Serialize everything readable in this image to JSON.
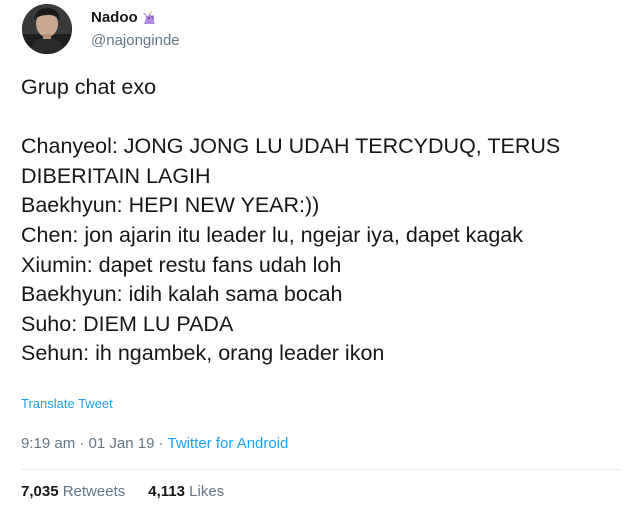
{
  "author": {
    "display_name": "Nadoo",
    "badge_icon": "unicorn-icon",
    "handle": "@najonginde"
  },
  "tweet": {
    "lines": [
      "Grup chat exo",
      "",
      "Chanyeol: JONG JONG LU UDAH TERCYDUQ, TERUS",
      "DIBERITAIN LAGIH",
      "Baekhyun: HEPI NEW YEAR:))",
      "Chen: jon ajarin itu leader lu, ngejar iya, dapet kagak",
      "Xiumin: dapet restu fans udah loh",
      "Baekhyun: idih kalah sama bocah",
      "Suho: DIEM LU PADA",
      "Sehun: ih ngambek, orang leader ikon"
    ],
    "translate_label": "Translate Tweet"
  },
  "meta": {
    "time": "9:19 am",
    "separator": "·",
    "date": "01 Jan 19",
    "source": "Twitter for Android"
  },
  "stats": {
    "retweets_count": "7,035",
    "retweets_label": "Retweets",
    "likes_count": "4,113",
    "likes_label": "Likes"
  },
  "colors": {
    "link": "#1da1f2",
    "muted": "#657786",
    "text": "#14171a",
    "divider": "#e6ecf0"
  }
}
